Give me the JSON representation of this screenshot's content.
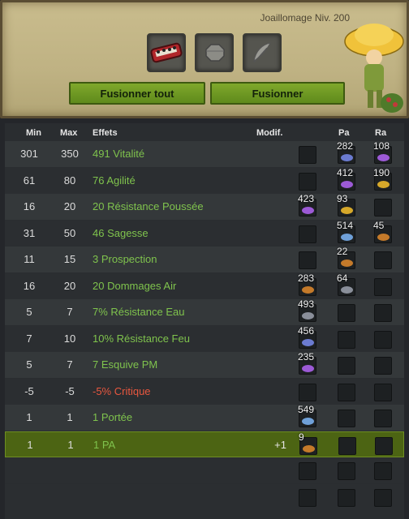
{
  "header": {
    "skill_label": "Joaillomage Niv. 200",
    "fuse_all_label": "Fusionner tout",
    "fuse_label": "Fusionner"
  },
  "slots": [
    {
      "icon": "red-belt-item-icon"
    },
    {
      "icon": "stone-rune-icon"
    },
    {
      "icon": "feather-icon"
    }
  ],
  "table": {
    "columns": {
      "min": "Min",
      "max": "Max",
      "effets": "Effets",
      "modif": "Modif.",
      "pa": "Pa",
      "ra": "Ra"
    },
    "rows": [
      {
        "min": "301",
        "max": "350",
        "effet": "491 Vitalité",
        "modif": "",
        "rune": "",
        "pa": "282",
        "ra": "108",
        "negative": false,
        "selected": false
      },
      {
        "min": "61",
        "max": "80",
        "effet": "76 Agilité",
        "modif": "",
        "rune": "",
        "pa": "412",
        "ra": "190",
        "negative": false,
        "selected": false
      },
      {
        "min": "16",
        "max": "20",
        "effet": "20 Résistance Poussée",
        "modif": "",
        "rune": "423",
        "pa": "93",
        "ra": "",
        "negative": false,
        "selected": false
      },
      {
        "min": "31",
        "max": "50",
        "effet": "46 Sagesse",
        "modif": "",
        "rune": "",
        "pa": "514",
        "ra": "45",
        "negative": false,
        "selected": false
      },
      {
        "min": "11",
        "max": "15",
        "effet": "3 Prospection",
        "modif": "",
        "rune": "",
        "pa": "22",
        "ra": "",
        "negative": false,
        "selected": false
      },
      {
        "min": "16",
        "max": "20",
        "effet": "20 Dommages Air",
        "modif": "",
        "rune": "283",
        "pa": "64",
        "ra": "",
        "negative": false,
        "selected": false
      },
      {
        "min": "5",
        "max": "7",
        "effet": "7% Résistance Eau",
        "modif": "",
        "rune": "493",
        "pa": "",
        "ra": "",
        "negative": false,
        "selected": false
      },
      {
        "min": "7",
        "max": "10",
        "effet": "10% Résistance Feu",
        "modif": "",
        "rune": "456",
        "pa": "",
        "ra": "",
        "negative": false,
        "selected": false
      },
      {
        "min": "5",
        "max": "7",
        "effet": "7 Esquive PM",
        "modif": "",
        "rune": "235",
        "pa": "",
        "ra": "",
        "negative": false,
        "selected": false
      },
      {
        "min": "-5",
        "max": "-5",
        "effet": "-5% Critique",
        "modif": "",
        "rune": "",
        "pa": "",
        "ra": "",
        "negative": true,
        "selected": false
      },
      {
        "min": "1",
        "max": "1",
        "effet": "1 Portée",
        "modif": "",
        "rune": "549",
        "pa": "",
        "ra": "",
        "negative": false,
        "selected": false
      },
      {
        "min": "1",
        "max": "1",
        "effet": "1 PA",
        "modif": "+1",
        "rune": "9",
        "pa": "",
        "ra": "",
        "negative": false,
        "selected": true
      }
    ]
  },
  "colors": {
    "positive_effect": "#7fc34d",
    "negative_effect": "#e8573f",
    "selected_row": "#4c6413",
    "button_green": "#6e9a22"
  }
}
